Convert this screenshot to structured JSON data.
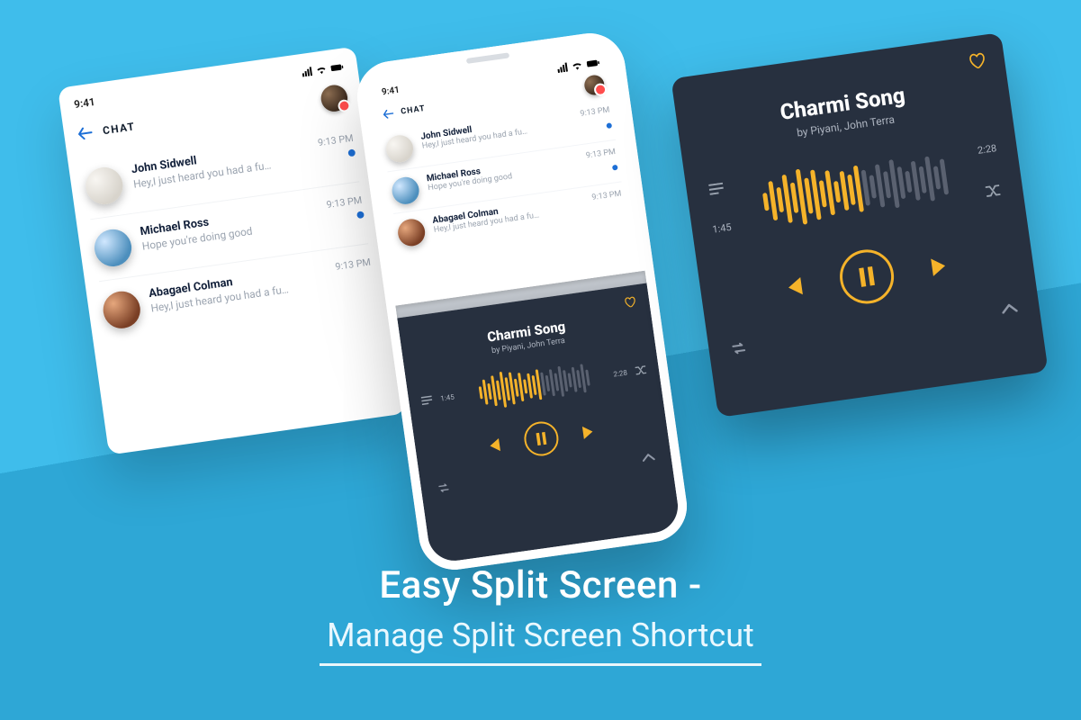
{
  "chat": {
    "statusTime": "9:41",
    "headerTitle": "CHAT",
    "items": [
      {
        "name": "John Sidwell",
        "msg": "Hey,I just heard you had a fu…",
        "time": "9:13 PM",
        "unread": true
      },
      {
        "name": "Michael Ross",
        "msg": "Hope you're doing good",
        "time": "9:13 PM",
        "unread": true
      },
      {
        "name": "Abagael Colman",
        "msg": "Hey,I just heard you had a fu…",
        "time": "9:13 PM",
        "unread": false
      }
    ]
  },
  "player": {
    "songTitle": "Charmi Song",
    "songArtist": "by Piyani, John Terra",
    "timeStart": "1:45",
    "timeEnd": "2:28"
  },
  "titles": {
    "main": "Easy Split Screen -",
    "sub": "Manage Split Screen Shortcut"
  }
}
